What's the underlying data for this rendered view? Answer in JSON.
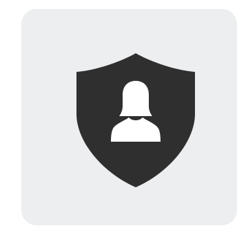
{
  "tile": {
    "background": "#eceeef"
  },
  "icon": {
    "name": "shield-user-icon",
    "shield_color": "#2f2f2f",
    "figure_color": "#ffffff"
  }
}
